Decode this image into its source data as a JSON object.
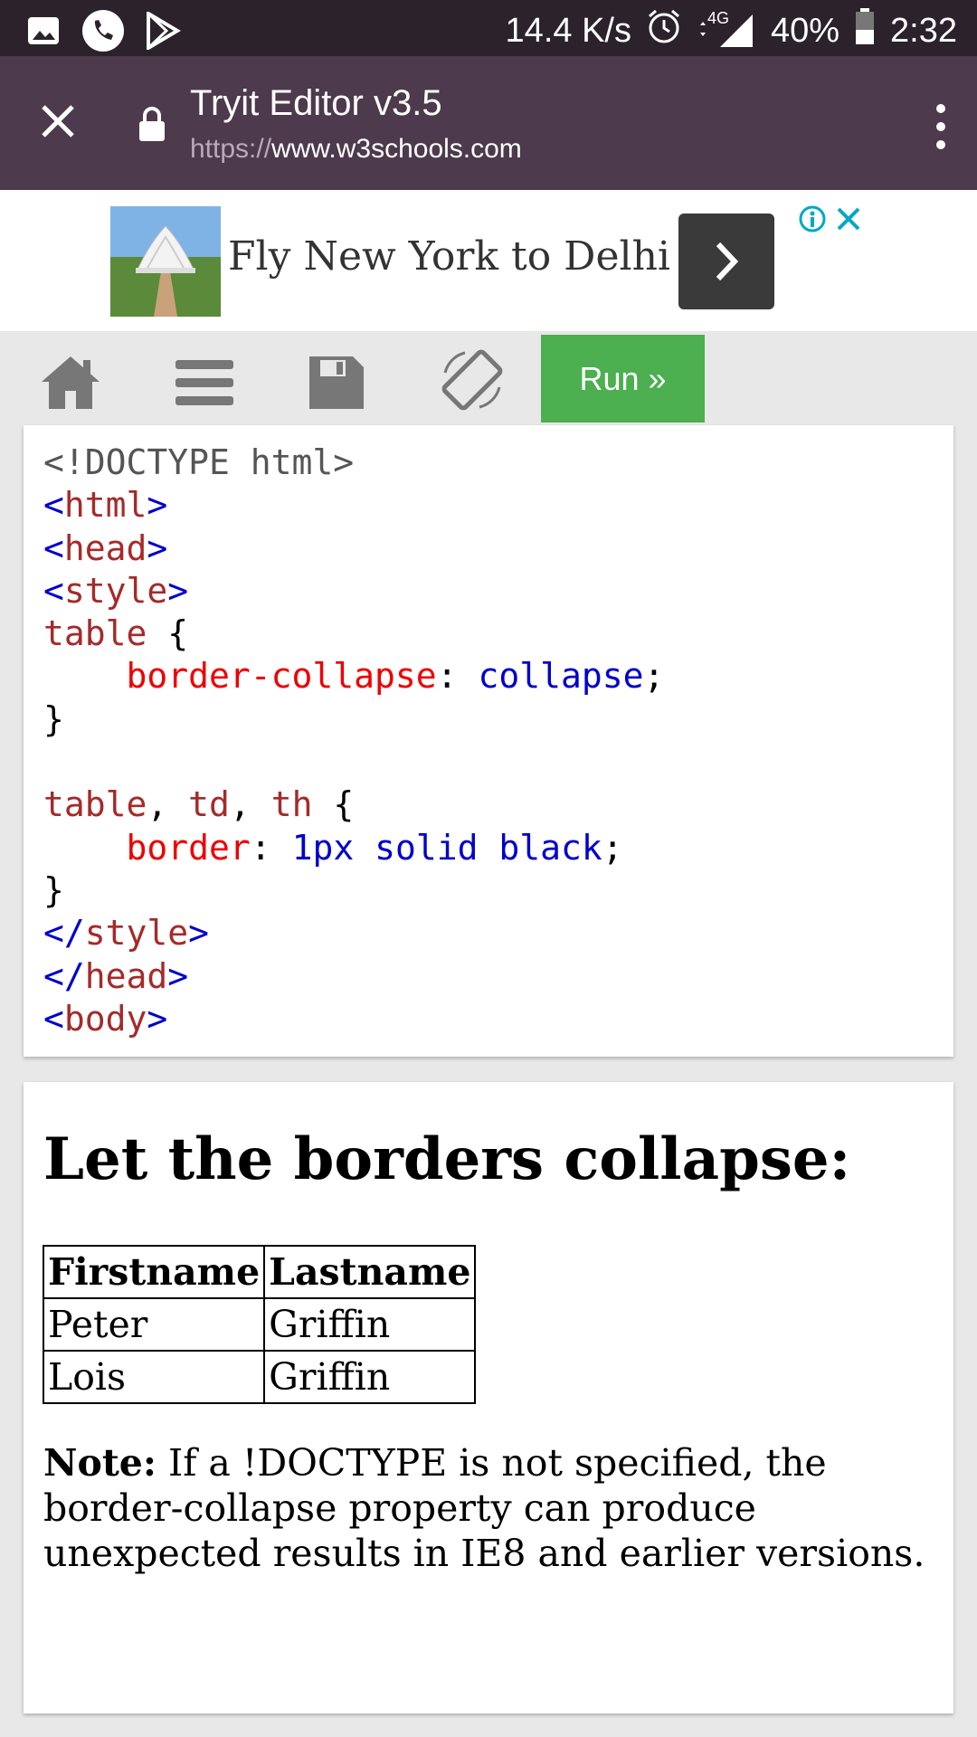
{
  "status_bar": {
    "net_speed": "14.4 K/s",
    "network_type": "4G",
    "battery": "40%",
    "time": "2:32",
    "icons": [
      "gallery-icon",
      "phone-icon",
      "play-store-icon",
      "alarm-icon",
      "signal-icon",
      "battery-icon"
    ]
  },
  "browser": {
    "title": "Tryit Editor v3.5",
    "url_scheme": "https://",
    "url_host": "www.w3schools.com"
  },
  "ad": {
    "text": "Fly New York to Delhi"
  },
  "editor_toolbar": {
    "run_label": "Run »",
    "icons": [
      "home-icon",
      "menu-icon",
      "save-icon",
      "rotate-icon"
    ],
    "run_color": "#4caf50"
  },
  "code": {
    "lines": [
      "<!DOCTYPE html>",
      "<html>",
      "<head>",
      "<style>",
      "table {",
      "    border-collapse: collapse;",
      "}",
      "",
      "table, td, th {",
      "    border: 1px solid black;",
      "}",
      "</style>",
      "</head>",
      "<body>"
    ]
  },
  "result": {
    "heading": "Let the borders collapse:",
    "table": {
      "headers": [
        "Firstname",
        "Lastname"
      ],
      "rows": [
        [
          "Peter",
          "Griffin"
        ],
        [
          "Lois",
          "Griffin"
        ]
      ]
    },
    "note_label": "Note:",
    "note_text": " If a !DOCTYPE is not specified, the border-collapse property can produce unexpected results in IE8 and earlier versions."
  },
  "colors": {
    "status_bar": "#2b222b",
    "toolbar": "#4d3a4d",
    "run_button": "#4caf50"
  }
}
